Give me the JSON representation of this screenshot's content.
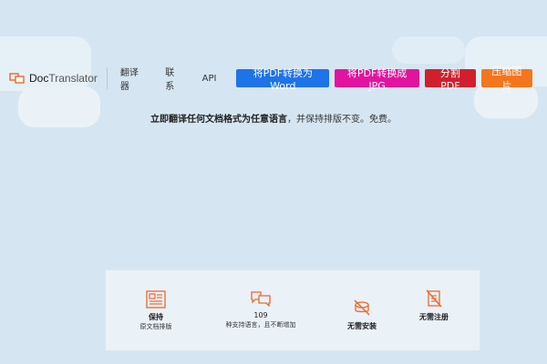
{
  "brand": {
    "name_part1": "Doc",
    "name_part2": "Translator"
  },
  "nav": {
    "links": [
      "翻译器",
      "联系",
      "API"
    ],
    "buttons": [
      {
        "label": "将PDF转换为Word",
        "color": "#1f73e8"
      },
      {
        "label": "将PDF转换成JPG",
        "color": "#e2149f"
      },
      {
        "label": "分割PDF",
        "color": "#d0202e"
      },
      {
        "label": "压缩图片",
        "color": "#f3761f"
      }
    ]
  },
  "tagline": {
    "bold": "立即翻译任何文档格式为任意语言",
    "rest": "，并保持排版不变。免费。"
  },
  "features": [
    {
      "icon": "layout-icon",
      "title": "保持",
      "subtitle": "原文档排版"
    },
    {
      "icon": "language-bubbles-icon",
      "title": "109",
      "subtitle": "种支持语言，且不断增加"
    },
    {
      "icon": "no-install-icon",
      "title": "无需安装",
      "subtitle": ""
    },
    {
      "icon": "no-registration-icon",
      "title": "无需注册",
      "subtitle": ""
    }
  ],
  "colors": {
    "accent": "#e86a2c",
    "background": "#d5e6f2"
  }
}
